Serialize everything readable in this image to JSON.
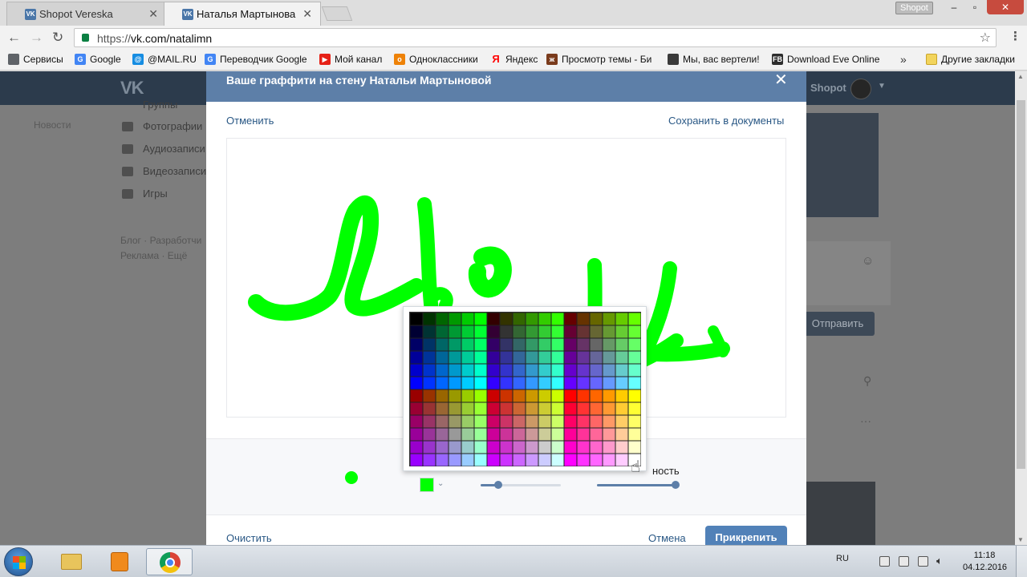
{
  "browser": {
    "tabs": [
      {
        "title": "Shopot Vereska",
        "active": false
      },
      {
        "title": "Наталья Мартынова",
        "active": true
      }
    ],
    "profile": "Shopot",
    "url_prefix": "https://",
    "url_host": "vk.com/natalimn",
    "bookmarks": [
      {
        "label": "Сервисы",
        "icon_color": "#5f6368"
      },
      {
        "label": "Google",
        "icon_color": "#4285f4"
      },
      {
        "label": "@MAIL.RU",
        "icon_color": "#168de2"
      },
      {
        "label": "Переводчик Google",
        "icon_color": "#4285f4"
      },
      {
        "label": "Мой канал",
        "icon_color": "#e62117"
      },
      {
        "label": "Одноклассники",
        "icon_color": "#ee8208"
      },
      {
        "label": "Яндекс",
        "icon_color": "#ff0000"
      },
      {
        "label": "Просмотр темы - Би",
        "icon_color": "#7a3b1c"
      },
      {
        "label": "Мы, вас вертели!",
        "icon_color": "#3a3a3a"
      },
      {
        "label": "Download Eve Online",
        "icon_color": "#2d2d2d"
      }
    ],
    "other_bookmarks": "Другие закладки"
  },
  "vk": {
    "user_name": "Shopot",
    "left_menu": [
      "Группы",
      "Фотографии",
      "Аудиозаписи",
      "Видеозаписи",
      "Игры"
    ],
    "footer_links_1": "Блог · Разработчи",
    "footer_links_2": "Реклама · Ещё",
    "news_label": "Новости",
    "send_button": "Отправить"
  },
  "modal": {
    "title": "Ваше граффити на стену Натальи Мартыновой",
    "cancel_link": "Отменить",
    "save_link": "Сохранить в документы",
    "opacity_label": "ность",
    "clear_link": "Очистить",
    "cancel_button": "Отмена",
    "attach_button": "Прикрепить",
    "brush_color": "#00ff00",
    "thickness_level": 0.22,
    "opacity_level": 1.0
  },
  "palette": {
    "rows": 12,
    "cols": 18
  },
  "taskbar": {
    "language": "RU",
    "time": "11:18",
    "date": "04.12.2016"
  },
  "colors": {
    "vk_header": "#5d7fa8",
    "vk_link": "#2a5885",
    "attach_button": "#5181b8",
    "close_button": "#c74b3e"
  }
}
